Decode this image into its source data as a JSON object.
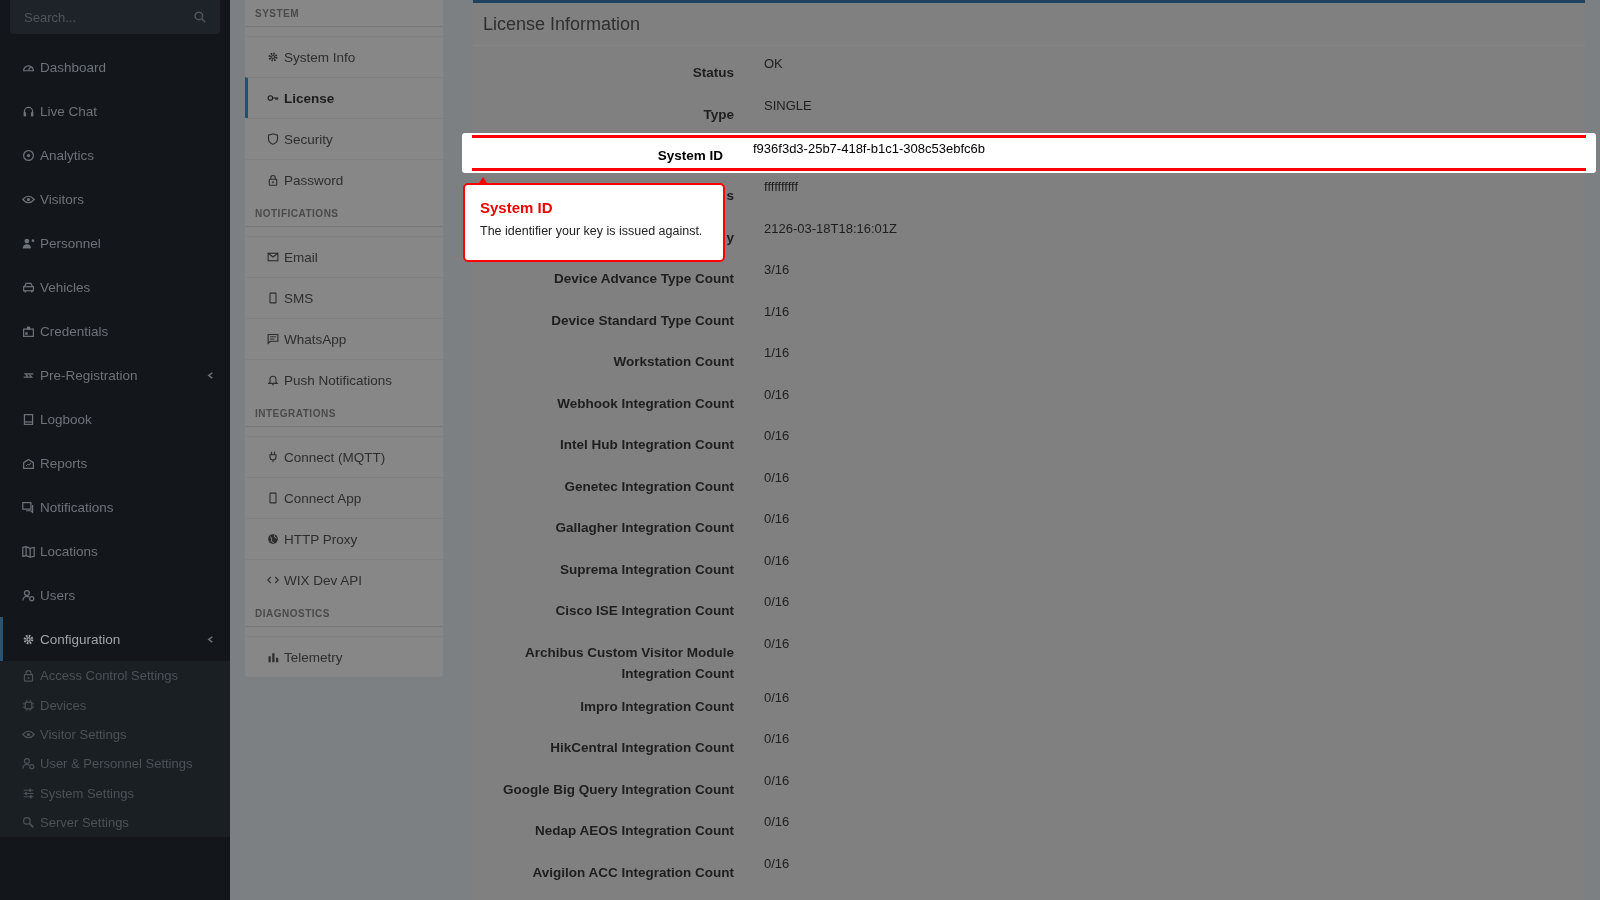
{
  "sidebar": {
    "search": {
      "placeholder": "Search..."
    },
    "items": [
      {
        "label": "Dashboard",
        "selected": false
      },
      {
        "label": "Live Chat",
        "selected": false
      },
      {
        "label": "Analytics",
        "selected": false
      },
      {
        "label": "Visitors",
        "selected": false
      },
      {
        "label": "Personnel",
        "selected": false
      },
      {
        "label": "Vehicles",
        "selected": false
      },
      {
        "label": "Credentials",
        "selected": false
      },
      {
        "label": "Pre-Registration",
        "selected": false,
        "submenu": true
      },
      {
        "label": "Logbook",
        "selected": false
      },
      {
        "label": "Reports",
        "selected": false
      },
      {
        "label": "Notifications",
        "selected": false
      },
      {
        "label": "Locations",
        "selected": false
      },
      {
        "label": "Users",
        "selected": false
      },
      {
        "label": "Configuration",
        "selected": true,
        "submenu": true,
        "children": [
          {
            "label": "Access Control Settings"
          },
          {
            "label": "Devices"
          },
          {
            "label": "Visitor Settings"
          },
          {
            "label": "User & Personnel Settings"
          },
          {
            "label": "System Settings"
          },
          {
            "label": "Server Settings"
          }
        ]
      }
    ]
  },
  "settings_nav": [
    {
      "heading": "SYSTEM",
      "items": [
        {
          "label": "System Info",
          "selected": false
        },
        {
          "label": "License",
          "selected": true
        },
        {
          "label": "Security",
          "selected": false
        },
        {
          "label": "Password",
          "selected": false
        }
      ]
    },
    {
      "heading": "NOTIFICATIONS",
      "items": [
        {
          "label": "Email",
          "selected": false
        },
        {
          "label": "SMS",
          "selected": false
        },
        {
          "label": "WhatsApp",
          "selected": false
        },
        {
          "label": "Push Notifications",
          "selected": false
        }
      ]
    },
    {
      "heading": "INTEGRATIONS",
      "items": [
        {
          "label": "Connect (MQTT)",
          "selected": false
        },
        {
          "label": "Connect App",
          "selected": false
        },
        {
          "label": "HTTP Proxy",
          "selected": false
        },
        {
          "label": "WIX Dev API",
          "selected": false
        }
      ]
    },
    {
      "heading": "DIAGNOSTICS",
      "items": [
        {
          "label": "Telemetry",
          "selected": false
        }
      ]
    }
  ],
  "license": {
    "title": "License Information",
    "rows": [
      {
        "label": "Status",
        "value": "OK",
        "highlighted": false
      },
      {
        "label": "Type",
        "value": "SINGLE",
        "highlighted": false
      },
      {
        "label": "System ID",
        "value": "f936f3d3-25b7-418f-b1c1-308c53ebfc6b",
        "highlighted": true
      },
      {
        "label": "s",
        "value": "ffffffffff",
        "highlighted": false
      },
      {
        "label": "y",
        "value": "2126-03-18T18:16:01Z",
        "highlighted": false
      },
      {
        "label": "Device Advance Type Count",
        "value": "3/16",
        "highlighted": false
      },
      {
        "label": "Device Standard Type Count",
        "value": "1/16",
        "highlighted": false
      },
      {
        "label": "Workstation Count",
        "value": "1/16",
        "highlighted": false
      },
      {
        "label": "Webhook Integration Count",
        "value": "0/16",
        "highlighted": false
      },
      {
        "label": "Intel Hub Integration Count",
        "value": "0/16",
        "highlighted": false
      },
      {
        "label": "Genetec Integration Count",
        "value": "0/16",
        "highlighted": false
      },
      {
        "label": "Gallagher Integration Count",
        "value": "0/16",
        "highlighted": false
      },
      {
        "label": "Suprema Integration Count",
        "value": "0/16",
        "highlighted": false
      },
      {
        "label": "Cisco ISE Integration Count",
        "value": "0/16",
        "highlighted": false
      },
      {
        "label": "Archibus Custom Visitor Module Integration Count",
        "value": "0/16",
        "highlighted": false
      },
      {
        "label": "Impro Integration Count",
        "value": "0/16",
        "highlighted": false
      },
      {
        "label": "HikCentral Integration Count",
        "value": "0/16",
        "highlighted": false
      },
      {
        "label": "Google Big Query Integration Count",
        "value": "0/16",
        "highlighted": false
      },
      {
        "label": "Nedap AEOS Integration Count",
        "value": "0/16",
        "highlighted": false
      },
      {
        "label": "Avigilon ACC Integration Count",
        "value": "0/16",
        "highlighted": false
      }
    ]
  },
  "tooltip": {
    "title": "System ID",
    "text": "The identifier your key is issued against."
  }
}
